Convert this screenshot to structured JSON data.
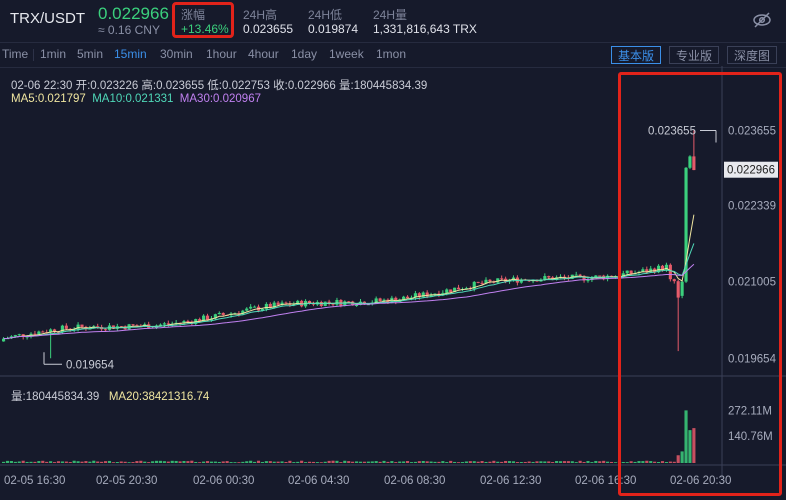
{
  "header": {
    "pair": "TRX/USDT",
    "last_price": "0.022966",
    "cny_price": "≈ 0.16 CNY",
    "change_label": "涨幅",
    "change_value": "+13.46%",
    "high_label": "24H高",
    "high_value": "0.023655",
    "low_label": "24H低",
    "low_value": "0.019874",
    "volume_label": "24H量",
    "volume_value": "1,331,816,643 TRX",
    "icon": "eye-off-icon"
  },
  "toolbar": {
    "timeframes": [
      "Time",
      "1min",
      "5min",
      "15min",
      "30min",
      "1hour",
      "4hour",
      "1day",
      "1week",
      "1mon"
    ],
    "active_timeframe": "15min",
    "views": [
      "基本版",
      "专业版",
      "深度图"
    ],
    "active_view": "基本版"
  },
  "info": {
    "ohlc": "02-06 22:30   开:0.023226  高:0.023655  低:0.022753  收:0.022966  量:180445834.39",
    "ma5": "MA5:0.021797",
    "ma10": "MA10:0.021331",
    "ma30": "MA30:0.020967",
    "volume": "量:180445834.39",
    "ma20": "MA20:38421316.74"
  },
  "colors": {
    "up": "#3bd07d",
    "down": "#e55b6a",
    "ma5": "#f0e6a0",
    "ma10": "#4fd8b8",
    "ma30": "#c080f0",
    "accent": "#3b8fe8",
    "highlight": "#e2231a"
  },
  "chart_data": {
    "type": "candlestick",
    "title": "",
    "price_axis_ticks": [
      "0.023655",
      "0.022339",
      "0.021005",
      "0.019654"
    ],
    "price_axis_values": [
      0.023655,
      0.022339,
      0.021005,
      0.019654
    ],
    "current_price_label": "0.022966",
    "ylim": [
      0.01936,
      0.02405
    ],
    "volume_axis_ticks": [
      "272.11M",
      "140.76M"
    ],
    "volume_axis_values": [
      272110000,
      140760000
    ],
    "x_ticks": [
      "02-05 16:30",
      "02-05 20:30",
      "02-06 00:30",
      "02-06 04:30",
      "02-06 08:30",
      "02-06 12:30",
      "02-06 16:30",
      "02-06 20:30"
    ],
    "annotations": [
      {
        "label": "0.023655",
        "value": 0.023655,
        "type": "high"
      },
      {
        "label": "0.019654",
        "value": 0.019654,
        "type": "low"
      }
    ],
    "legend": [
      "MA5",
      "MA10",
      "MA30"
    ],
    "grid": false
  }
}
